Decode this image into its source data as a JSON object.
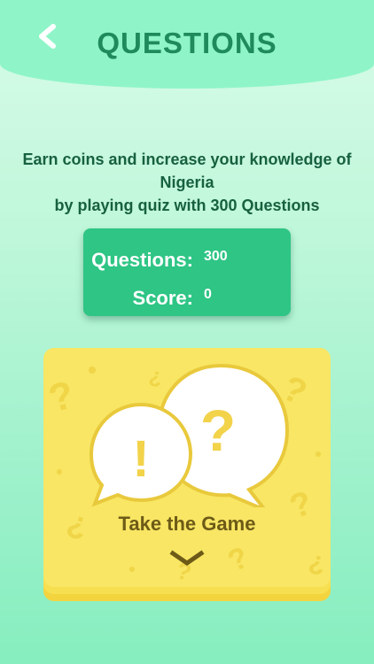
{
  "header": {
    "title": "QUESTIONS",
    "back_icon": "chevron-left-icon"
  },
  "intro": {
    "line1": "Earn coins and increase your knowledge of",
    "line2": "Nigeria",
    "line3": "by playing quiz with 300 Questions"
  },
  "stats": {
    "questions_label": "Questions:",
    "questions_value": "300",
    "score_label": "Score:",
    "score_value": "0"
  },
  "game_card": {
    "label": "Take the Game",
    "icon": "speech-bubbles-icon",
    "arrow_icon": "chevron-down-icon"
  },
  "colors": {
    "header_bg": "#8ff5c8",
    "title": "#1f8a5c",
    "stats_card": "#2ec585",
    "game_card": "#f8e664",
    "game_text": "#6d5a17"
  }
}
